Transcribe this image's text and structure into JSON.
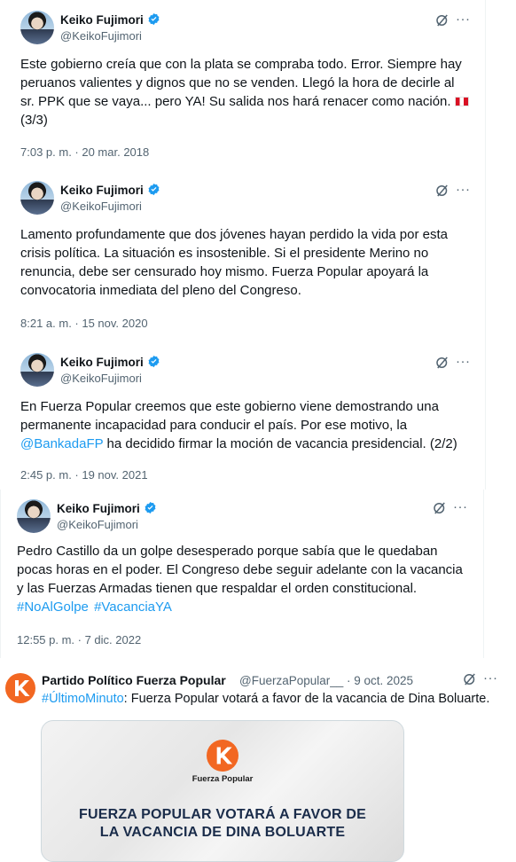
{
  "tweets": [
    {
      "name": "Keiko Fujimori",
      "handle": "@KeikoFujimori",
      "text_lines": [
        "Este gobierno creía que con la plata se compraba todo. Error. Siempre hay",
        "peruanos valientes y dignos que no se venden. Llegó la hora de decirle al",
        "sr. PPK que se vaya... pero YA! Su salida nos hará renacer como nación."
      ],
      "text_tail": "(3/3)",
      "timestamp": "7:03 p. m. · 20 mar. 2018"
    },
    {
      "name": "Keiko Fujimori",
      "handle": "@KeikoFujimori",
      "text_lines": [
        "Lamento profundamente que dos jóvenes hayan perdido la vida por esta",
        "crisis política. La situación es insostenible. Si el presidente Merino no",
        "renuncia, debe ser censurado hoy mismo. Fuerza Popular apoyará la",
        "convocatoria inmediata del pleno del Congreso."
      ],
      "timestamp": "8:21 a. m. · 15 nov. 2020"
    },
    {
      "name": "Keiko Fujimori",
      "handle": "@KeikoFujimori",
      "text_lines": [
        "En Fuerza Popular creemos que este  gobierno viene demostrando una",
        "permanente incapacidad para conducir el país. Por ese motivo, la"
      ],
      "mention": "@BankadaFP",
      "text_after_mention": " ha decidido firmar la moción de vacancia presidencial. (2/2)",
      "timestamp": "2:45 p. m. · 19 nov. 2021"
    },
    {
      "name": "Keiko Fujimori",
      "handle": "@KeikoFujimori",
      "text_lines": [
        "Pedro Castillo da un golpe desesperado porque sabía que le quedaban",
        "pocas horas en el poder. El Congreso debe seguir adelante con la vacancia",
        "y las Fuerzas Armadas tienen que respaldar el orden constitucional."
      ],
      "hashtags": [
        "#NoAlGolpe",
        "#VacanciaYA"
      ],
      "timestamp": "12:55 p. m. · 7 dic. 2022"
    }
  ],
  "fp_post": {
    "name": "Partido Político Fuerza Popular",
    "handle_date": "@FuerzaPopular__ · 9 oct. 2025",
    "hashtag": "#ÚltimoMinuto",
    "text": ": Fuerza Popular votará a favor de la vacancia de Dina Boluarte.",
    "card_brand": "Fuerza Popular",
    "card_headline_1": "FUERZA POPULAR VOTARÁ A FAVOR DE",
    "card_headline_2": "LA VACANCIA DE DINA BOLUARTE"
  },
  "icons": {
    "verified": "verified-badge-icon",
    "grok": "grok-icon",
    "more": "more-options-icon"
  },
  "colors": {
    "verified": "#1d9bf0",
    "link": "#1d9bf0",
    "secondary_text": "#536471",
    "fp_orange": "#f26722"
  },
  "more_glyph": "···"
}
